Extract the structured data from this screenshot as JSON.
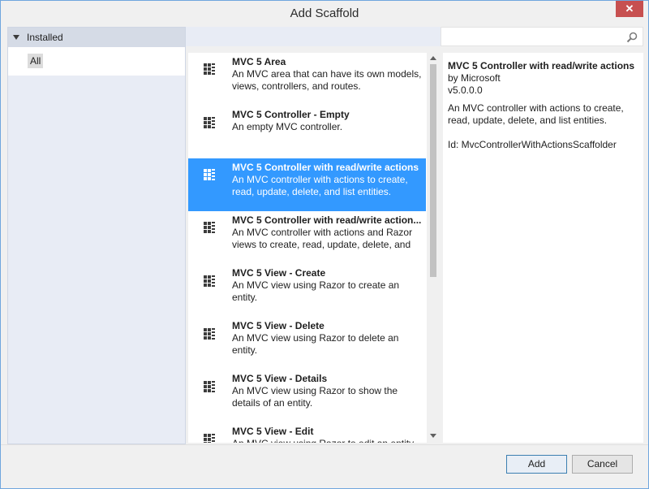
{
  "window": {
    "title": "Add Scaffold",
    "close_label": "✕"
  },
  "tree": {
    "installed_label": "Installed",
    "all_label": "All"
  },
  "search": {
    "placeholder": ""
  },
  "list": [
    {
      "title": "MVC 5 Area",
      "description": "An MVC area that can have its own models, views, controllers, and routes."
    },
    {
      "title": "MVC 5 Controller - Empty",
      "description": "An empty MVC controller."
    },
    {
      "title": "MVC 5 Controller with read/write actions",
      "description": "An MVC controller with actions to create, read, update, delete, and list entities."
    },
    {
      "title": "MVC 5 Controller with read/write action...",
      "description": "An MVC controller with actions and Razor views to create, read, update, delete, and lis..."
    },
    {
      "title": "MVC 5 View - Create",
      "description": "An MVC view using Razor to create an entity."
    },
    {
      "title": "MVC 5 View - Delete",
      "description": "An MVC view using Razor to delete an entity."
    },
    {
      "title": "MVC 5 View - Details",
      "description": "An MVC view using Razor to show the details of an entity."
    },
    {
      "title": "MVC 5 View - Edit",
      "description": "An MVC view using Razor to edit an entity."
    }
  ],
  "selected_index": 2,
  "detail": {
    "title": "MVC 5 Controller with read/write actions",
    "author": "by Microsoft",
    "version": "v5.0.0.0",
    "description": "An MVC controller with actions to create, read, update, delete, and list entities.",
    "id": "Id: MvcControllerWithActionsScaffolder"
  },
  "buttons": {
    "add_label": "Add",
    "cancel_label": "Cancel"
  },
  "colors": {
    "selection": "#3399ff",
    "close": "#c75050",
    "tree_bg": "#e8ecf5"
  }
}
